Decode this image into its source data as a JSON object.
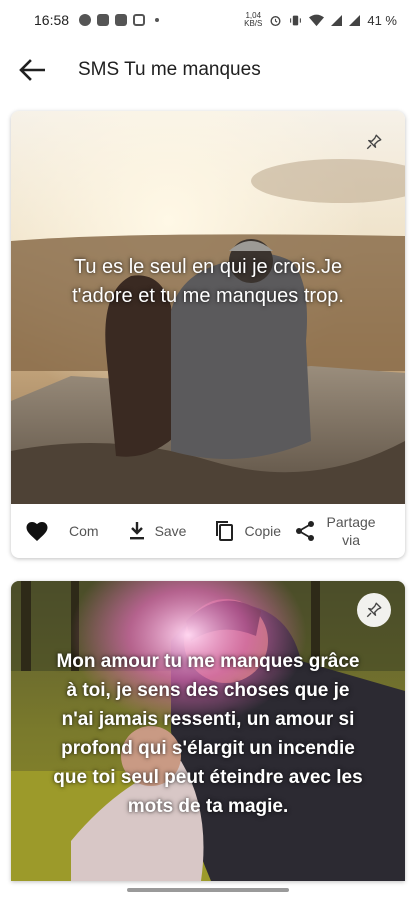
{
  "status_bar": {
    "time": "16:58",
    "net_speed_top": "1,04",
    "net_speed_bottom": "KB/S",
    "battery": "41 %"
  },
  "app_bar": {
    "title": "SMS Tu me manques",
    "back_icon": "arrow-back-icon"
  },
  "cards": [
    {
      "quote": "Tu es le seul en qui je crois.Je t'adore et tu me manques trop.",
      "actions": {
        "com_label": "Com",
        "save_label": "Save",
        "copy_label": "Copie",
        "share_label_1": "Partage",
        "share_label_2": "via"
      }
    },
    {
      "quote": "Mon amour tu me manques grâce à toi, je sens des choses que je n'ai jamais ressenti, un amour si profond qui s'élargit un incendie que toi seul peut éteindre avec les mots de ta magie."
    }
  ],
  "colors": {
    "text_primary": "#202020",
    "text_secondary": "#555555",
    "heart": "#111111"
  }
}
